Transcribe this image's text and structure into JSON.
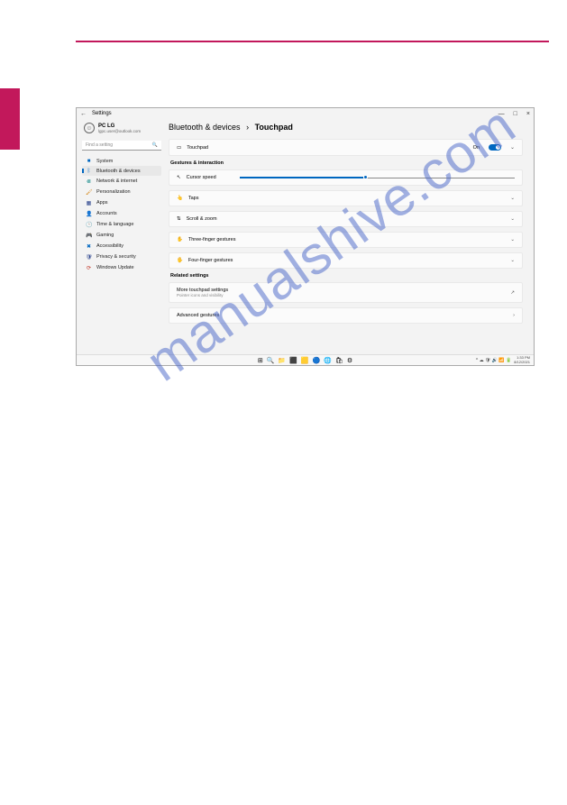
{
  "watermark": "manualshive.com",
  "window": {
    "title": "Settings",
    "controls": {
      "min": "—",
      "max": "□",
      "close": "×"
    }
  },
  "user": {
    "name": "PC LG",
    "email": "lgpc.user@outlook.com"
  },
  "search": {
    "placeholder": "Find a setting",
    "icon": "🔍"
  },
  "nav": [
    {
      "icon": "■",
      "label": "System",
      "cls": "c-blue"
    },
    {
      "icon": "ᛒ",
      "label": "Bluetooth & devices",
      "cls": "c-blue",
      "active": true
    },
    {
      "icon": "⋐",
      "label": "Network & internet",
      "cls": "c-teal"
    },
    {
      "icon": "🖌",
      "label": "Personalization",
      "cls": "c-orange"
    },
    {
      "icon": "▦",
      "label": "Apps",
      "cls": "c-navy"
    },
    {
      "icon": "👤",
      "label": "Accounts",
      "cls": "c-teal"
    },
    {
      "icon": "🕒",
      "label": "Time & language",
      "cls": "c-navy"
    },
    {
      "icon": "🎮",
      "label": "Gaming",
      "cls": "c-green"
    },
    {
      "icon": "✖",
      "label": "Accessibility",
      "cls": "c-blue"
    },
    {
      "icon": "🛡",
      "label": "Privacy & security",
      "cls": "c-navy"
    },
    {
      "icon": "⟳",
      "label": "Windows Update",
      "cls": "c-red"
    }
  ],
  "breadcrumb": {
    "a": "Bluetooth & devices",
    "sep": "›",
    "b": "Touchpad"
  },
  "touchpad_card": {
    "icon": "▭",
    "label": "Touchpad",
    "state": "On"
  },
  "section_gestures": "Gestures & interaction",
  "rows": {
    "cursor": {
      "icon": "↖",
      "label": "Cursor speed"
    },
    "taps": {
      "icon": "👆",
      "label": "Taps"
    },
    "scroll": {
      "icon": "⇅",
      "label": "Scroll & zoom"
    },
    "three": {
      "icon": "✋",
      "label": "Three-finger gestures"
    },
    "four": {
      "icon": "🖐",
      "label": "Four-finger gestures"
    }
  },
  "section_related": "Related settings",
  "more": {
    "label": "More touchpad settings",
    "sub": "Pointer icons and visibility"
  },
  "advanced": {
    "label": "Advanced gestures"
  },
  "taskbar": {
    "icons": [
      "⊞",
      "🔍",
      "📁",
      "⬛",
      "🟨",
      "🔵",
      "🌐",
      "🛍",
      "⚙"
    ],
    "tray": [
      "^",
      "☁",
      "🛡",
      "🔊",
      "📶",
      "🔋"
    ],
    "time": "1:33 PM",
    "date": "8/12/2021"
  }
}
